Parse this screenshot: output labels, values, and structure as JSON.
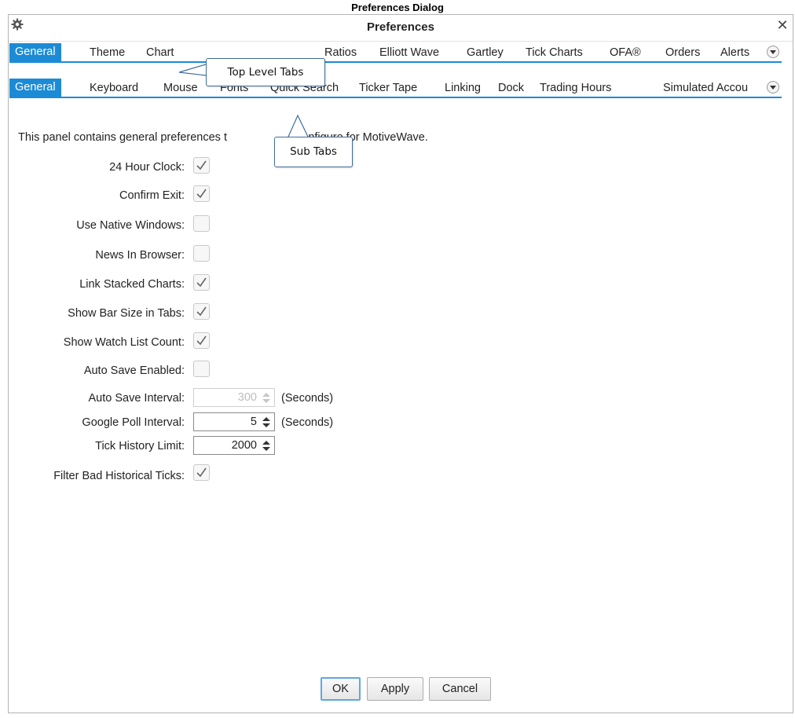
{
  "page_title": "Preferences Dialog",
  "dialog": {
    "title": "Preferences",
    "close_glyph": "✕"
  },
  "top_tabs": [
    "General",
    "Theme",
    "Chart",
    "Ratios",
    "Elliott Wave",
    "Gartley",
    "Tick Charts",
    "OFA®",
    "Orders",
    "Alerts"
  ],
  "sub_tabs": [
    "General",
    "Keyboard",
    "Mouse",
    "Fonts",
    "Quick Search",
    "Ticker Tape",
    "Linking",
    "Dock",
    "Trading Hours",
    "Simulated Accou"
  ],
  "callouts": {
    "top": "Top Level Tabs",
    "sub": "Sub Tabs"
  },
  "panel": {
    "description": "This panel contains general preferences t",
    "description_tail": "configure for MotiveWave.",
    "checkboxes": [
      {
        "label": "24 Hour Clock:",
        "checked": true
      },
      {
        "label": "Confirm Exit:",
        "checked": true
      },
      {
        "label": "Use Native Windows:",
        "checked": false
      },
      {
        "label": "News In Browser:",
        "checked": false
      },
      {
        "label": "Link Stacked Charts:",
        "checked": true
      },
      {
        "label": "Show Bar Size in Tabs:",
        "checked": true
      },
      {
        "label": "Show Watch List Count:",
        "checked": true
      },
      {
        "label": "Auto Save Enabled:",
        "checked": false
      }
    ],
    "auto_save_interval": {
      "label": "Auto Save Interval:",
      "value": "300",
      "unit": "(Seconds)"
    },
    "google_poll_interval": {
      "label": "Google Poll Interval:",
      "value": "5",
      "unit": "(Seconds)"
    },
    "tick_history_limit": {
      "label": "Tick History Limit:",
      "value": "2000"
    },
    "filter_bad_ticks": {
      "label": "Filter Bad Historical Ticks:",
      "checked": true
    }
  },
  "buttons": {
    "ok": "OK",
    "apply": "Apply",
    "cancel": "Cancel"
  },
  "colors": {
    "accent": "#1c8bd6",
    "callout_border": "#3f6d9a"
  },
  "icons": {
    "settings": "gear-icon",
    "close": "close-icon",
    "overflow": "chevron-down-icon",
    "check": "check-icon"
  }
}
